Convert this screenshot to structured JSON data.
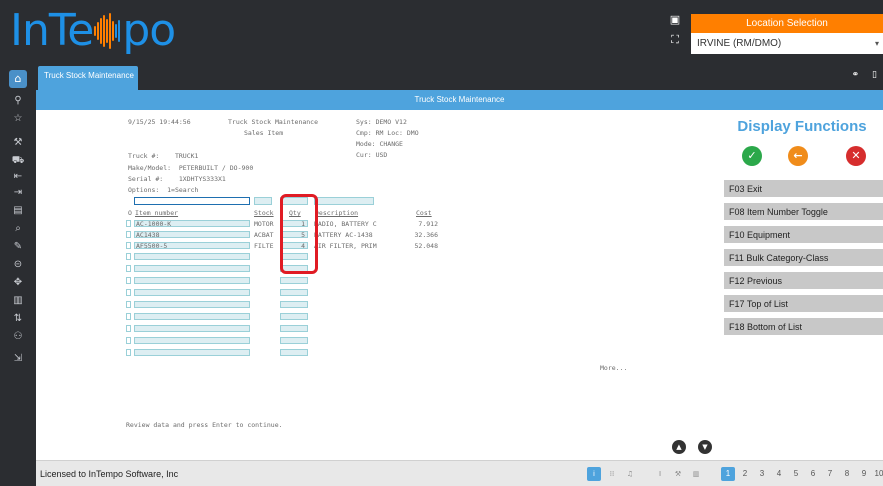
{
  "app": {
    "logo_text_left": "InTe",
    "logo_text_right": "po"
  },
  "location": {
    "title": "Location Selection",
    "selected": "IRVINE (RM/DMO)"
  },
  "tab": {
    "label": "Truck Stock Maintenance"
  },
  "titlebar": {
    "label": "Truck Stock Maintenance"
  },
  "screen": {
    "datetime": "9/15/25 19:44:56",
    "title": "Truck Stock Maintenance",
    "subtitle": "Sales Item",
    "sys": "Sys: DEMO V12",
    "cmp": "Cmp: RM Loc: DMO",
    "mode": "Mode: CHANGE",
    "cur": "Cur: USD",
    "truck": "Truck #:    TRUCK1",
    "make_model": "Make/Model:  PETERBUILT / DO-900",
    "serial": "Serial #:    1XDHTYS333X1",
    "options": "Options:  1=Search",
    "columns": {
      "o": "O",
      "item": "Item number",
      "stock": "Stock",
      "qty": "Qty",
      "desc": "Description",
      "cost": "Cost"
    },
    "rows": [
      {
        "item": "AC-1000-K",
        "stock": "MOTOR",
        "qty": "1",
        "desc": "RADIO, BATTERY C",
        "cost": "7.912"
      },
      {
        "item": "AC1438",
        "stock": "ACBAT",
        "qty": "5",
        "desc": "BATTERY AC-1438",
        "cost": "32.366"
      },
      {
        "item": "AF5500-5",
        "stock": "FILTE",
        "qty": "4",
        "desc": "AIR FILTER, PRIM",
        "cost": "52.048"
      }
    ],
    "more": "More...",
    "message": "Review data and press Enter to continue."
  },
  "functions": {
    "title": "Display Functions",
    "buttons": [
      "F03 Exit",
      "F08 Item Number Toggle",
      "F10 Equipment",
      "F11 Bulk Category-Class",
      "F12 Previous",
      "F17 Top of List",
      "F18 Bottom of List"
    ]
  },
  "footer": {
    "license": "Licensed to InTempo Software, Inc",
    "pages": [
      "1",
      "2",
      "3",
      "4",
      "5",
      "6",
      "7",
      "8",
      "9",
      "10"
    ]
  },
  "colors": {
    "accent": "#4ea3dd",
    "location": "#ff7f00",
    "highlight": "#e01b24"
  },
  "icons": {
    "rail": [
      "home-icon",
      "search-icon",
      "star-icon",
      "wrench-icon",
      "cart-icon",
      "transfer-in-icon",
      "transfer-out-icon",
      "clipboard-icon",
      "inspect-icon",
      "tool-icon",
      "lock-icon",
      "move-icon",
      "delete-icon",
      "swap-icon",
      "user-group-icon",
      "logout-icon"
    ]
  }
}
